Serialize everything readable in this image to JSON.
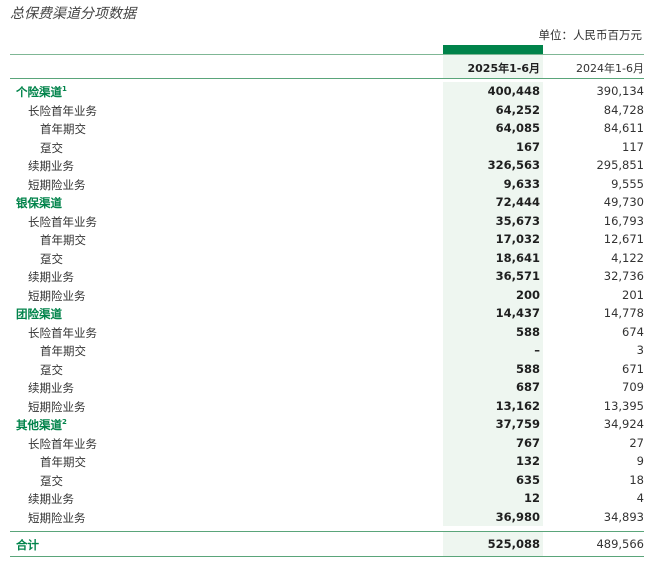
{
  "title": "总保费渠道分项数据",
  "unit": "单位：人民币百万元",
  "header": {
    "col1": "2025年1-6月",
    "col2": "2024年1-6月"
  },
  "rows": [
    {
      "label": "个险渠道",
      "sup": "1",
      "level": 0,
      "v2025": "400,448",
      "v2024": "390,134"
    },
    {
      "label": "长险首年业务",
      "sup": "",
      "level": 1,
      "v2025": "64,252",
      "v2024": "84,728"
    },
    {
      "label": "首年期交",
      "sup": "",
      "level": 2,
      "v2025": "64,085",
      "v2024": "84,611"
    },
    {
      "label": "趸交",
      "sup": "",
      "level": 2,
      "v2025": "167",
      "v2024": "117"
    },
    {
      "label": "续期业务",
      "sup": "",
      "level": 1,
      "v2025": "326,563",
      "v2024": "295,851"
    },
    {
      "label": "短期险业务",
      "sup": "",
      "level": 1,
      "v2025": "9,633",
      "v2024": "9,555"
    },
    {
      "label": "银保渠道",
      "sup": "",
      "level": 0,
      "v2025": "72,444",
      "v2024": "49,730"
    },
    {
      "label": "长险首年业务",
      "sup": "",
      "level": 1,
      "v2025": "35,673",
      "v2024": "16,793"
    },
    {
      "label": "首年期交",
      "sup": "",
      "level": 2,
      "v2025": "17,032",
      "v2024": "12,671"
    },
    {
      "label": "趸交",
      "sup": "",
      "level": 2,
      "v2025": "18,641",
      "v2024": "4,122"
    },
    {
      "label": "续期业务",
      "sup": "",
      "level": 1,
      "v2025": "36,571",
      "v2024": "32,736"
    },
    {
      "label": "短期险业务",
      "sup": "",
      "level": 1,
      "v2025": "200",
      "v2024": "201"
    },
    {
      "label": "团险渠道",
      "sup": "",
      "level": 0,
      "v2025": "14,437",
      "v2024": "14,778"
    },
    {
      "label": "长险首年业务",
      "sup": "",
      "level": 1,
      "v2025": "588",
      "v2024": "674"
    },
    {
      "label": "首年期交",
      "sup": "",
      "level": 2,
      "v2025": "–",
      "v2024": "3"
    },
    {
      "label": "趸交",
      "sup": "",
      "level": 2,
      "v2025": "588",
      "v2024": "671"
    },
    {
      "label": "续期业务",
      "sup": "",
      "level": 1,
      "v2025": "687",
      "v2024": "709"
    },
    {
      "label": "短期险业务",
      "sup": "",
      "level": 1,
      "v2025": "13,162",
      "v2024": "13,395"
    },
    {
      "label": "其他渠道",
      "sup": "2",
      "level": 0,
      "v2025": "37,759",
      "v2024": "34,924"
    },
    {
      "label": "长险首年业务",
      "sup": "",
      "level": 1,
      "v2025": "767",
      "v2024": "27"
    },
    {
      "label": "首年期交",
      "sup": "",
      "level": 2,
      "v2025": "132",
      "v2024": "9"
    },
    {
      "label": "趸交",
      "sup": "",
      "level": 2,
      "v2025": "635",
      "v2024": "18"
    },
    {
      "label": "续期业务",
      "sup": "",
      "level": 1,
      "v2025": "12",
      "v2024": "4"
    },
    {
      "label": "短期险业务",
      "sup": "",
      "level": 1,
      "v2025": "36,980",
      "v2024": "34,893"
    }
  ],
  "total": {
    "label": "合计",
    "v2025": "525,088",
    "v2024": "489,566"
  },
  "colors": {
    "accent": "#00834a",
    "highlight": "#eef6f0"
  }
}
